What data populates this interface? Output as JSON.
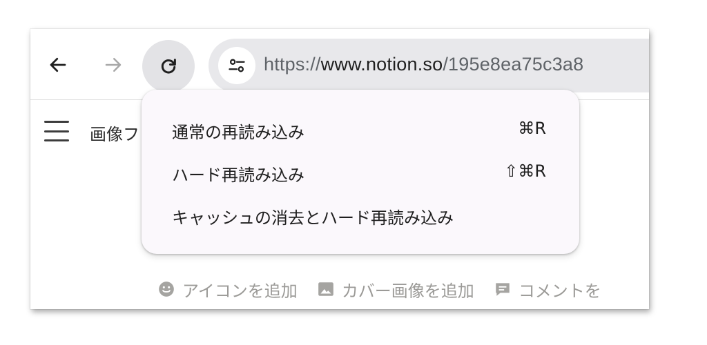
{
  "toolbar": {
    "back_icon": "arrow-left-icon",
    "forward_icon": "arrow-right-icon",
    "reload_icon": "reload-icon",
    "site_info_icon": "tune-icon",
    "url": {
      "scheme": "https://",
      "host": "www.notion.so",
      "path": "/195e8ea75c3a8"
    }
  },
  "page": {
    "breadcrumb": "画像フ",
    "actions": [
      {
        "icon": "smiley-icon",
        "label": "アイコンを追加"
      },
      {
        "icon": "image-icon",
        "label": "カバー画像を追加"
      },
      {
        "icon": "comment-icon",
        "label": "コメントを"
      }
    ]
  },
  "reload_menu": {
    "items": [
      {
        "label": "通常の再読み込み",
        "shortcut": "⌘R"
      },
      {
        "label": "ハード再読み込み",
        "shortcut": "⇧⌘R"
      },
      {
        "label": "キャッシュの消去とハード再読み込み",
        "shortcut": ""
      }
    ]
  },
  "colors": {
    "toolbar_bg": "#ffffff",
    "address_bar_bg": "#e8e8eb",
    "reload_button_bg": "#e3e3e6",
    "menu_bg": "#fbf8fc",
    "muted_text": "#9b9a97"
  }
}
